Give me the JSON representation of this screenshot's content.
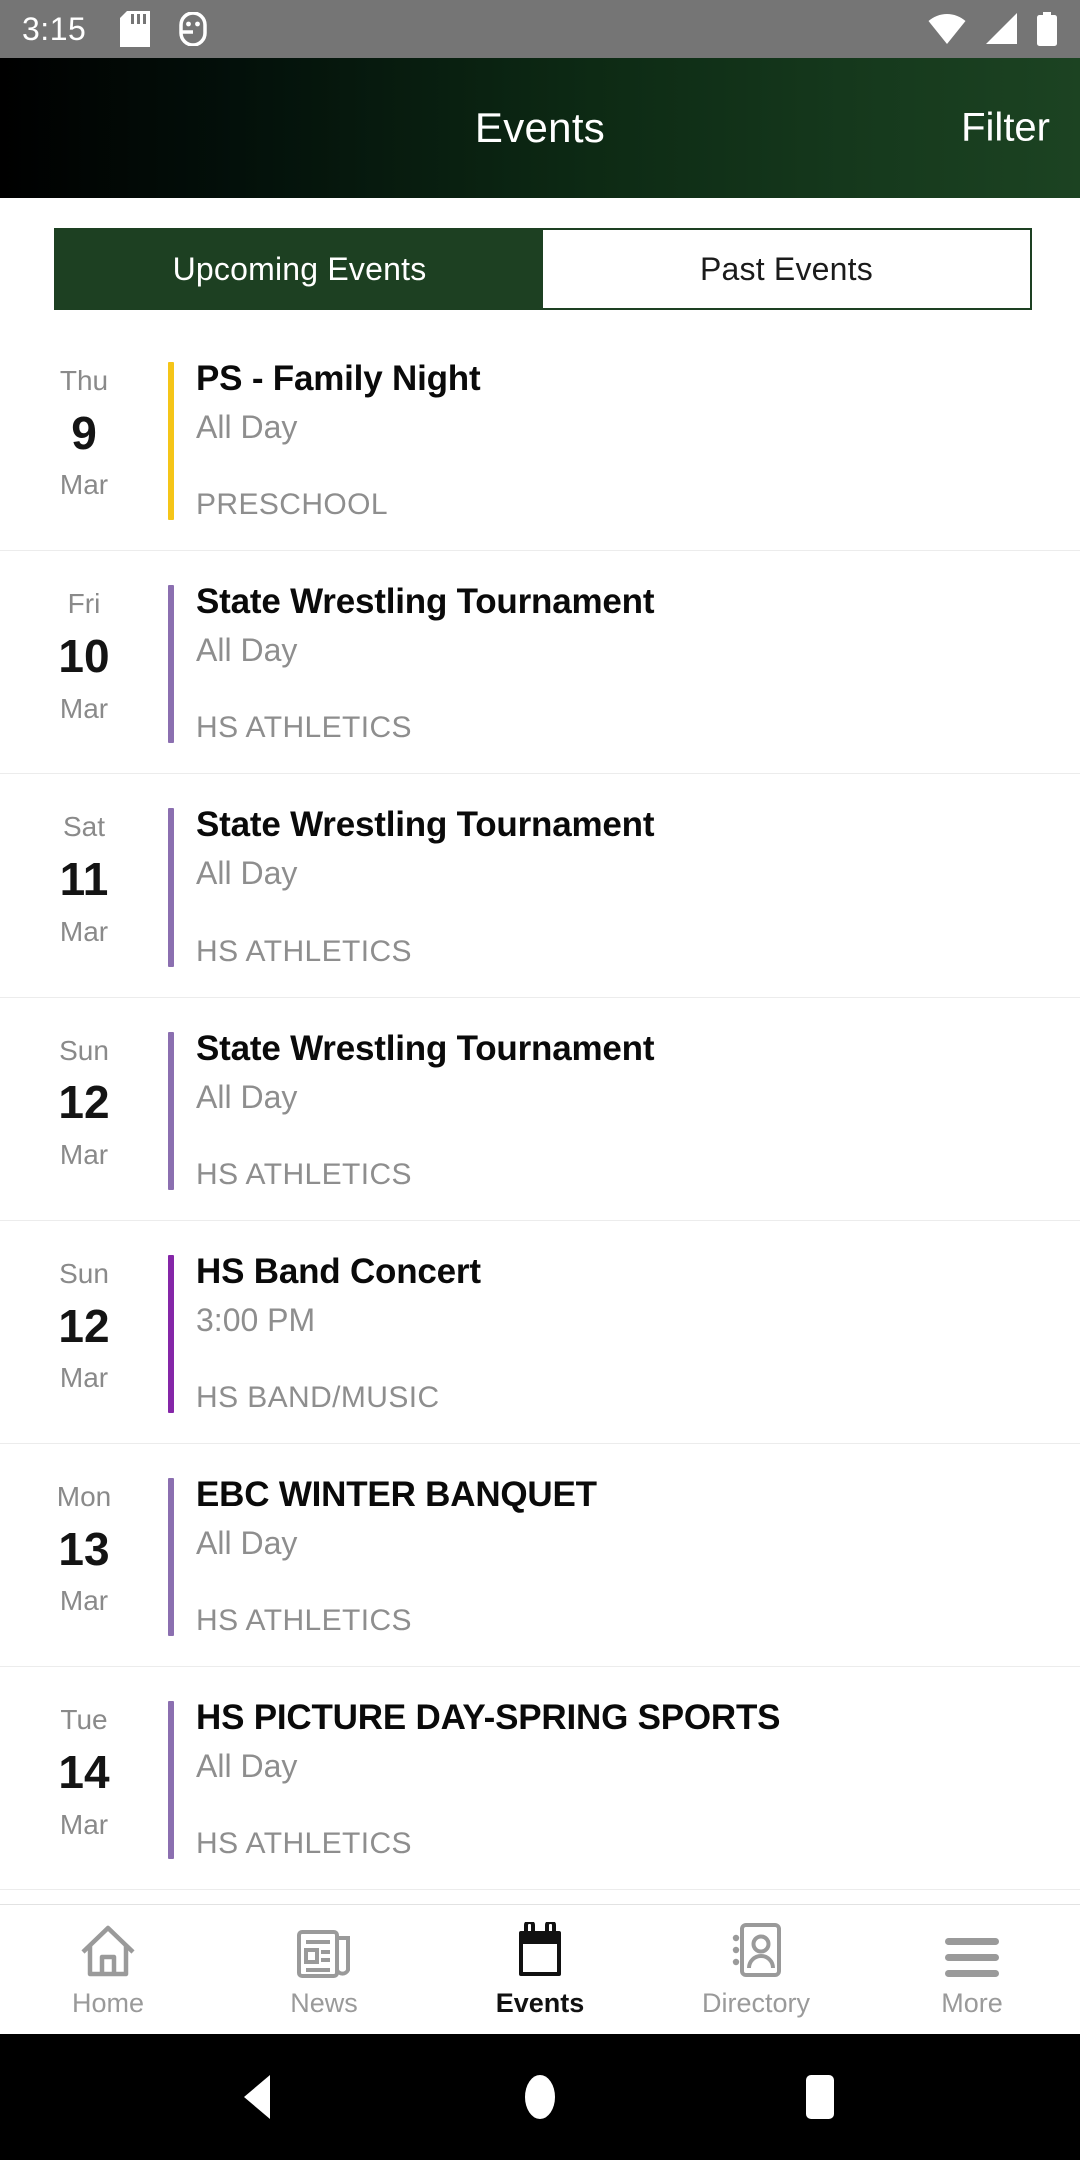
{
  "status_bar": {
    "time": "3:15",
    "left_icons": [
      "sd-card-icon",
      "android-debug-icon"
    ],
    "right_icons": [
      "wifi-icon",
      "cell-signal-icon",
      "battery-icon"
    ],
    "background_color": "#757575"
  },
  "header": {
    "title": "Events",
    "action_label": "Filter",
    "gradient_from": "#000000",
    "gradient_to": "#1c4322"
  },
  "tabs": {
    "active_index": 0,
    "active_color": "#1d4022",
    "items": [
      {
        "label": "Upcoming Events"
      },
      {
        "label": "Past Events"
      }
    ]
  },
  "events": [
    {
      "dow": "Thu",
      "day": "9",
      "month": "Mar",
      "title": "PS - Family Night",
      "time": "All Day",
      "category": "PRESCHOOL",
      "accent_color": "#f5c518"
    },
    {
      "dow": "Fri",
      "day": "10",
      "month": "Mar",
      "title": "State Wrestling Tournament",
      "time": "All Day",
      "category": "HS ATHLETICS",
      "accent_color": "#8b6fb0"
    },
    {
      "dow": "Sat",
      "day": "11",
      "month": "Mar",
      "title": "State Wrestling Tournament",
      "time": "All Day",
      "category": "HS ATHLETICS",
      "accent_color": "#8b6fb0"
    },
    {
      "dow": "Sun",
      "day": "12",
      "month": "Mar",
      "title": "State Wrestling Tournament",
      "time": "All Day",
      "category": "HS ATHLETICS",
      "accent_color": "#8b6fb0"
    },
    {
      "dow": "Sun",
      "day": "12",
      "month": "Mar",
      "title": "HS Band Concert",
      "time": "3:00 PM",
      "category": "HS BAND/MUSIC",
      "accent_color": "#8526a8"
    },
    {
      "dow": "Mon",
      "day": "13",
      "month": "Mar",
      "title": "EBC WINTER BANQUET",
      "time": "All Day",
      "category": "HS ATHLETICS",
      "accent_color": "#8b6fb0"
    },
    {
      "dow": "Tue",
      "day": "14",
      "month": "Mar",
      "title": "HS PICTURE DAY-SPRING SPORTS",
      "time": "All Day",
      "category": "HS ATHLETICS",
      "accent_color": "#8b6fb0"
    }
  ],
  "bottom_nav": {
    "active_index": 2,
    "items": [
      {
        "label": "Home",
        "icon": "home-icon"
      },
      {
        "label": "News",
        "icon": "newspaper-icon"
      },
      {
        "label": "Events",
        "icon": "calendar-icon"
      },
      {
        "label": "Directory",
        "icon": "contact-card-icon"
      },
      {
        "label": "More",
        "icon": "hamburger-menu-icon"
      }
    ]
  },
  "android_nav": {
    "buttons": [
      "back-button",
      "home-button",
      "recents-button"
    ]
  }
}
